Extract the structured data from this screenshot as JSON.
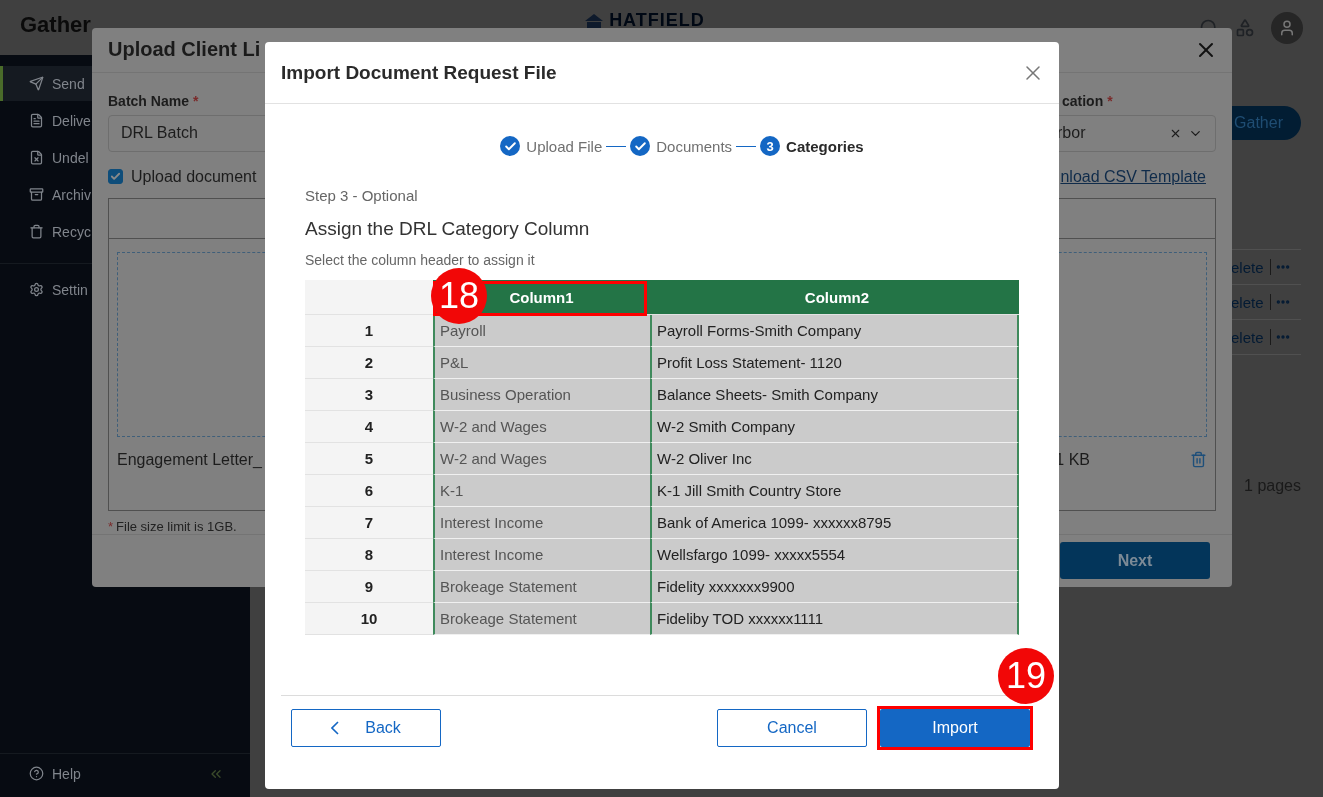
{
  "app": {
    "logo": "Gather",
    "brand": "HATFIELD"
  },
  "sidebar": {
    "items": [
      {
        "label": "Send",
        "selected": true
      },
      {
        "label": "Delive",
        "selected": false
      },
      {
        "label": "Undel",
        "selected": false
      },
      {
        "label": "Archiv",
        "selected": false
      },
      {
        "label": "Recyc",
        "selected": false
      }
    ],
    "settings": "Settin",
    "help": "Help"
  },
  "main": {
    "action_button": "Gather",
    "rows": [
      {
        "action": "elete"
      },
      {
        "action": "elete"
      },
      {
        "action": "elete"
      }
    ],
    "pagination": "1  pages"
  },
  "upload_dialog": {
    "title": "Upload Client Li",
    "batch_label": "Batch Name",
    "batch_required": "*",
    "batch_value": "DRL Batch",
    "location_label": "cation",
    "location_required": "*",
    "location_value": "rbor",
    "upload_checkbox": {
      "label": "Upload document",
      "checked": true
    },
    "template_link": "nload CSV Template",
    "file": {
      "name": "Engagement Letter_",
      "size": "1 KB"
    },
    "note_mark": "*",
    "note": "File size limit is 1GB.",
    "next_button": "Next"
  },
  "import_dialog": {
    "title": "Import Document Request File",
    "steps": [
      {
        "label": "Upload File",
        "done": true,
        "current": false
      },
      {
        "label": "Documents",
        "done": true,
        "current": false
      },
      {
        "label": "Categories",
        "number": "3",
        "done": false,
        "current": true
      }
    ],
    "step_caption": "Step 3 - Optional",
    "heading": "Assign the DRL Category Column",
    "instruction": "Select the column header to assign it",
    "table": {
      "columns": [
        "Column1",
        "Column2"
      ],
      "rows": [
        {
          "index": "1",
          "column_1": "Payroll",
          "column_2": "Payroll Forms-Smith Company"
        },
        {
          "index": "2",
          "column_1": "P&L",
          "column_2": "Profit Loss Statement- 1120"
        },
        {
          "index": "3",
          "column_1": "Business Operation",
          "column_2": "Balance Sheets- Smith Company"
        },
        {
          "index": "4",
          "column_1": "W-2 and Wages",
          "column_2": "W-2 Smith Company"
        },
        {
          "index": "5",
          "column_1": "W-2 and Wages",
          "column_2": "W-2 Oliver Inc"
        },
        {
          "index": "6",
          "column_1": "K-1",
          "column_2": "K-1 Jill Smith Country Store"
        },
        {
          "index": "7",
          "column_1": "Interest Income",
          "column_2": "Bank of America 1099- xxxxxx8795"
        },
        {
          "index": "8",
          "column_1": "Interest Income",
          "column_2": "Wellsfargo 1099- xxxxx5554"
        },
        {
          "index": "9",
          "column_1": "Brokeage Statement",
          "column_2": "Fidelity xxxxxxx9900"
        },
        {
          "index": "10",
          "column_1": "Brokeage Statement",
          "column_2": "Fideliby TOD xxxxxx1111"
        }
      ]
    },
    "buttons": {
      "back": "Back",
      "cancel": "Cancel",
      "import": "Import"
    }
  },
  "annotations": [
    {
      "label": "18"
    },
    {
      "label": "19"
    }
  ]
}
